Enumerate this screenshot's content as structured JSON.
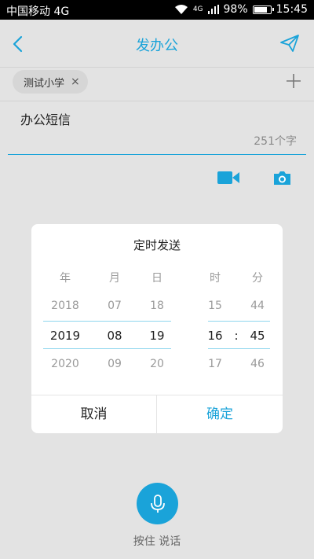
{
  "status_bar": {
    "carrier": "中国移动 4G",
    "network": "4G",
    "battery": "98%",
    "battery_level": 0.98,
    "time": "15:45"
  },
  "header": {
    "title": "发办公",
    "back_icon": "chevron-left-icon",
    "send_icon": "paper-plane-icon"
  },
  "recipients": {
    "chips": [
      {
        "label": "测试小学"
      }
    ],
    "remove_glyph": "×",
    "add_icon": "plus-icon"
  },
  "message": {
    "label": "办公短信",
    "char_count": "251个字"
  },
  "attachments": {
    "video_icon": "video-camera-icon",
    "photo_icon": "camera-icon"
  },
  "dialog": {
    "title": "定时发送",
    "columns": {
      "year": {
        "header": "年",
        "values": [
          "2018",
          "2019",
          "2020"
        ]
      },
      "month": {
        "header": "月",
        "values": [
          "07",
          "08",
          "09"
        ]
      },
      "day": {
        "header": "日",
        "values": [
          "18",
          "19",
          "20"
        ]
      },
      "hour": {
        "header": "时",
        "values": [
          "15",
          "16",
          "17"
        ]
      },
      "minute": {
        "header": "分",
        "values": [
          "44",
          "45",
          "46"
        ]
      }
    },
    "colon": ":",
    "cancel": "取消",
    "confirm": "确定"
  },
  "voice": {
    "label": "按住 说话",
    "icon": "microphone-icon"
  },
  "colors": {
    "accent": "#1aa3d9",
    "background": "#e3e3e3"
  }
}
